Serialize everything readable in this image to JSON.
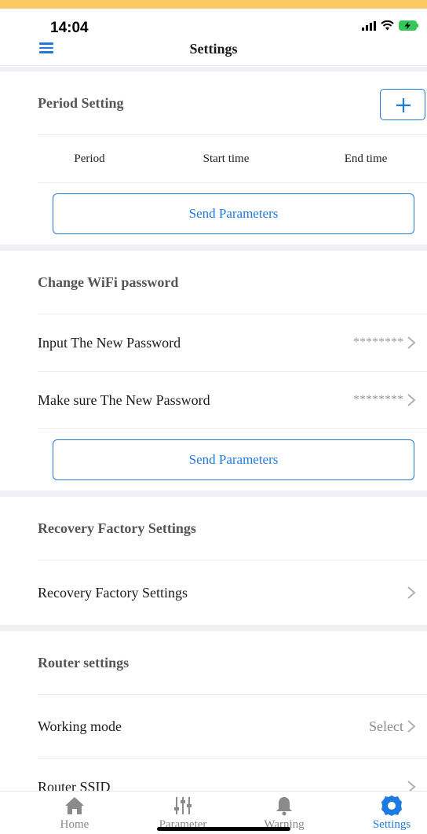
{
  "status": {
    "time": "14:04"
  },
  "nav": {
    "title": "Settings"
  },
  "period_section": {
    "title": "Period Setting",
    "columns": [
      "Period",
      "Start time",
      "End time"
    ],
    "send_label": "Send Parameters"
  },
  "wifi_section": {
    "title": "Change WiFi password",
    "rows": [
      {
        "label": "Input The New Password",
        "value": "********"
      },
      {
        "label": "Make sure The New Password",
        "value": "********"
      }
    ],
    "send_label": "Send Parameters"
  },
  "factory_section": {
    "title": "Recovery Factory Settings",
    "row_label": "Recovery Factory Settings"
  },
  "router_section": {
    "title": "Router settings",
    "rows": [
      {
        "label": "Working mode",
        "value": "Select"
      },
      {
        "label": "Router SSID",
        "value": ""
      }
    ]
  },
  "tabs": [
    {
      "label": "Home",
      "icon": "home-icon"
    },
    {
      "label": "Parameter",
      "icon": "sliders-icon"
    },
    {
      "label": "Warning",
      "icon": "bell-icon"
    },
    {
      "label": "Settings",
      "icon": "gear-icon",
      "active": true
    }
  ],
  "colors": {
    "accent": "#1f7ae0",
    "status_strip": "#fbc864",
    "battery": "#34c759"
  }
}
